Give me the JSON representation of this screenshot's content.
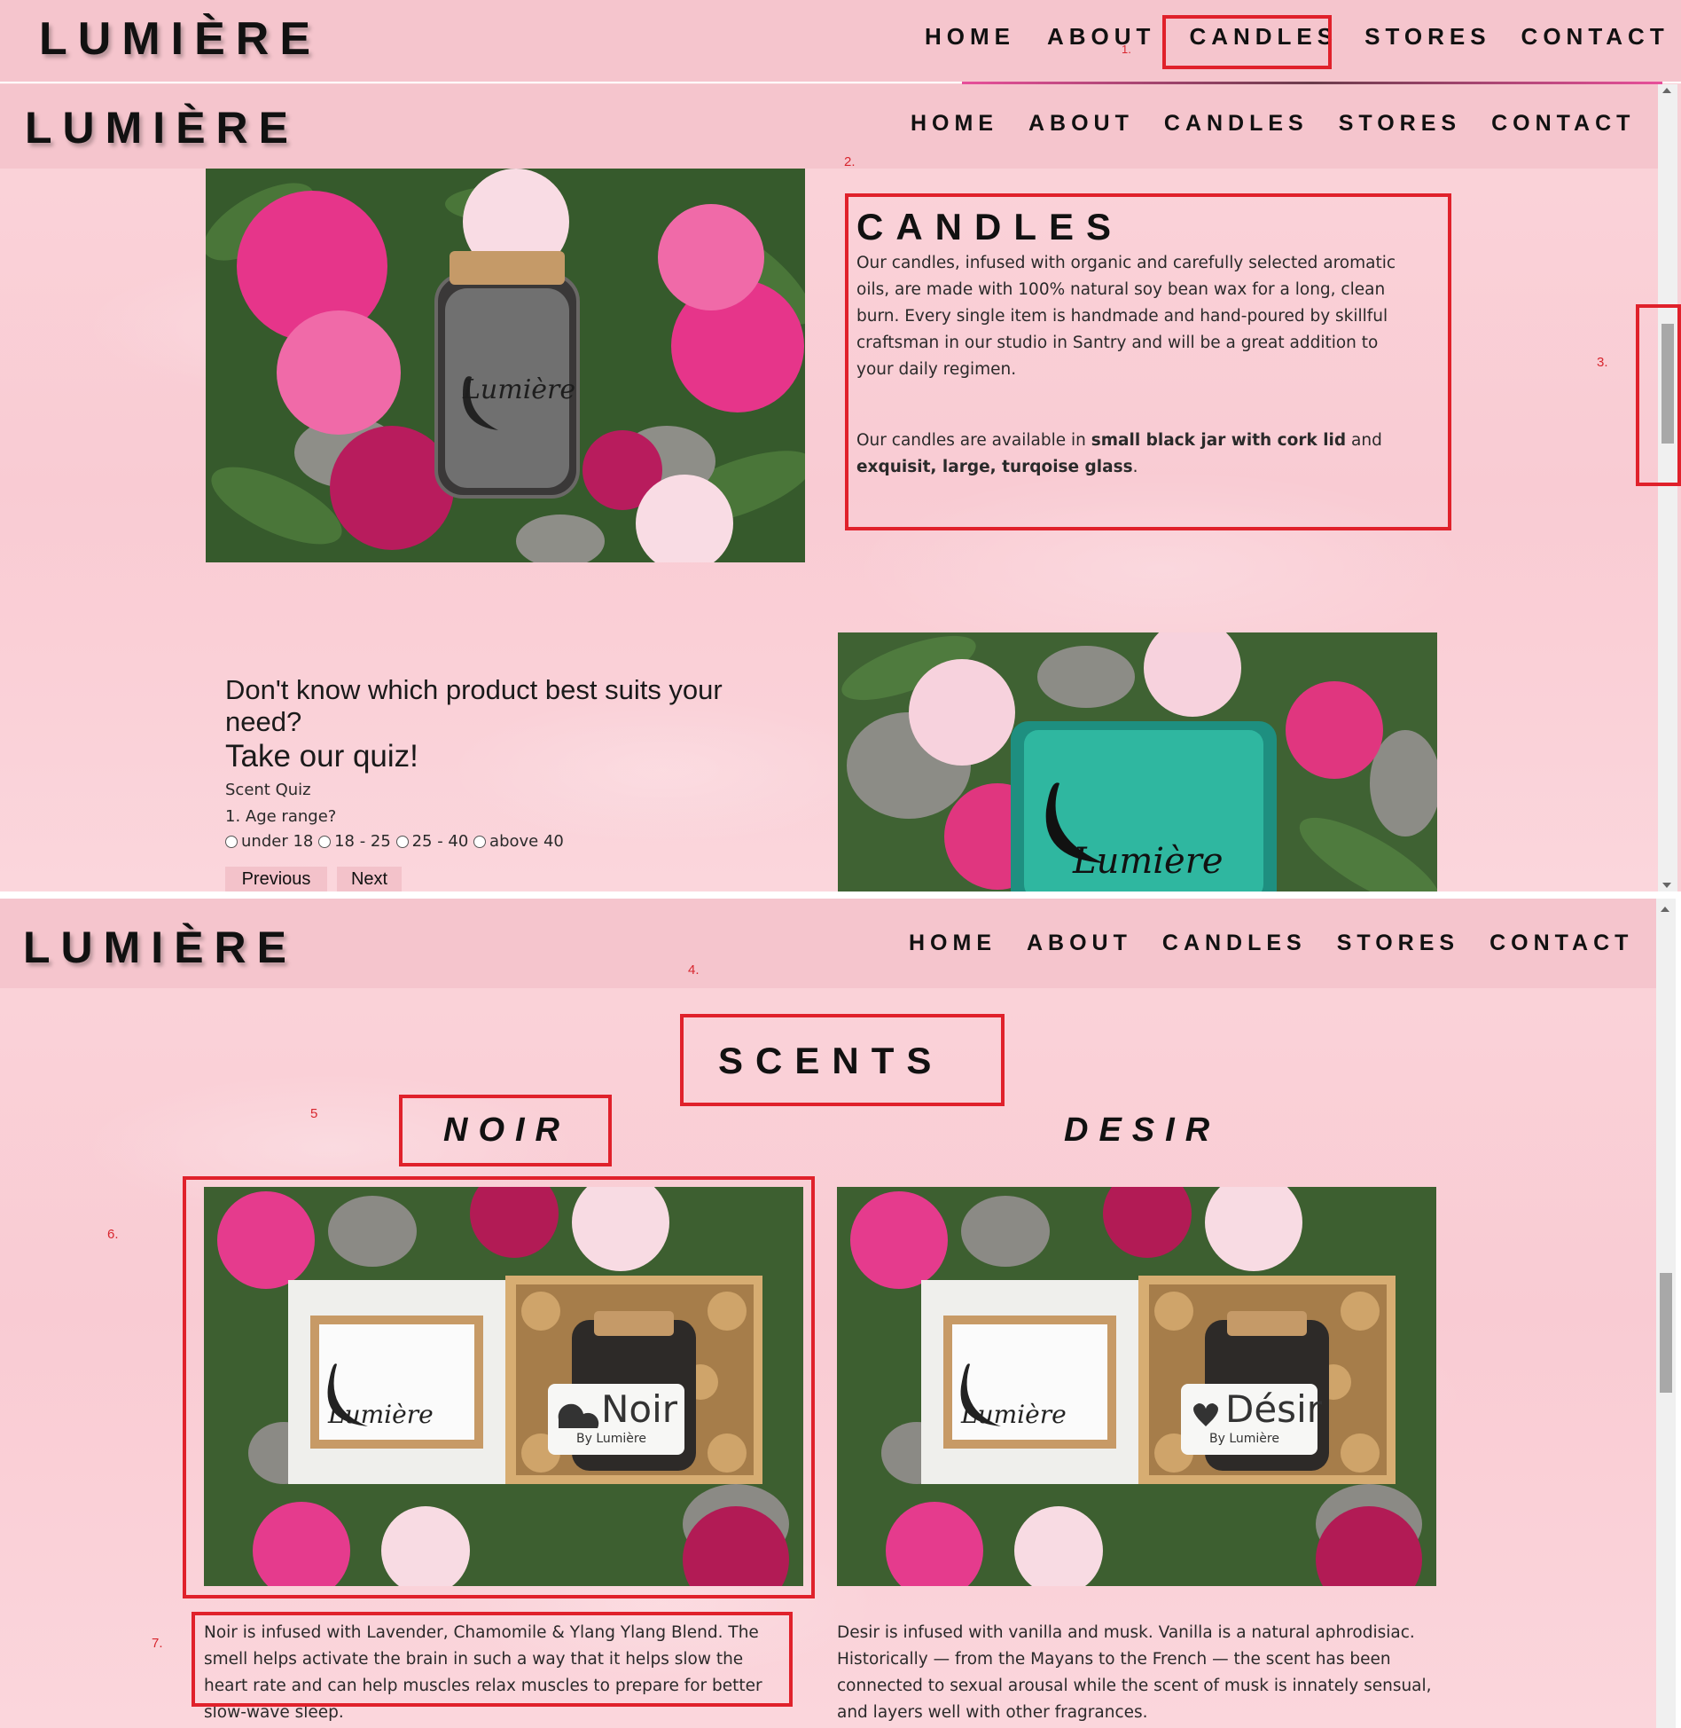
{
  "brand": {
    "logo_text": "LUMIÈRE"
  },
  "nav": {
    "home": "HOME",
    "about": "ABOUT",
    "candles": "CANDLES",
    "stores": "STORES",
    "contact": "CONTACT"
  },
  "markers": {
    "m1": "1.",
    "m2": "2.",
    "m3": "3.",
    "m4": "4.",
    "m5": "5",
    "m6": "6.",
    "m7": "7."
  },
  "candles_section": {
    "heading": "CANDLES",
    "paragraph1": "Our candles, infused with organic and carefully selected aromatic oils, are made with 100% natural soy bean wax for a long, clean burn. Every single item is handmade and hand-poured by skillful craftsman in our studio in Santry and will be a great addition to your daily regimen.",
    "p2_pre": "Our candles are available in ",
    "p2_bold1": "small black jar with cork lid",
    "p2_mid": " and ",
    "p2_bold2": "exquisit, large, turqoise glass",
    "p2_end": ".",
    "jar_label": "Lumière",
    "glass_label": "Lumière"
  },
  "quiz": {
    "heading1": "Don't know which product best suits your need?",
    "heading2": "Take our quiz!",
    "title": "Scent Quiz",
    "question": "1. Age range?",
    "options": [
      "under 18",
      "18 - 25",
      "25 - 40",
      "above 40"
    ],
    "previous": "Previous",
    "next": "Next"
  },
  "scents_section": {
    "heading": "SCENTS",
    "noir": {
      "name": "NOIR",
      "card_logo": "Lumière",
      "jar_label": "Noir",
      "jar_sub": "By Lumière",
      "description": "Noir is infused with Lavender, Chamomile & Ylang Ylang Blend. The smell helps activate the brain in such a way that it helps slow the heart rate and can help muscles relax muscles to prepare for better slow-wave sleep."
    },
    "desir": {
      "name": "DESIR",
      "card_logo": "Lumière",
      "jar_label": "Désir",
      "jar_sub": "By Lumière",
      "description": "Desir is infused with vanilla and musk. Vanilla is a natural aphrodisiac. Historically — from the Mayans to the French — the scent has been connected to sexual arousal while the scent of musk is innately sensual, and layers well with other fragrances."
    }
  },
  "colors": {
    "highlight_box": "#e0212b",
    "header_bg": "#f5c5cd",
    "page_bg": "#f8d0d6",
    "turquoise": "#2fb7a0"
  }
}
